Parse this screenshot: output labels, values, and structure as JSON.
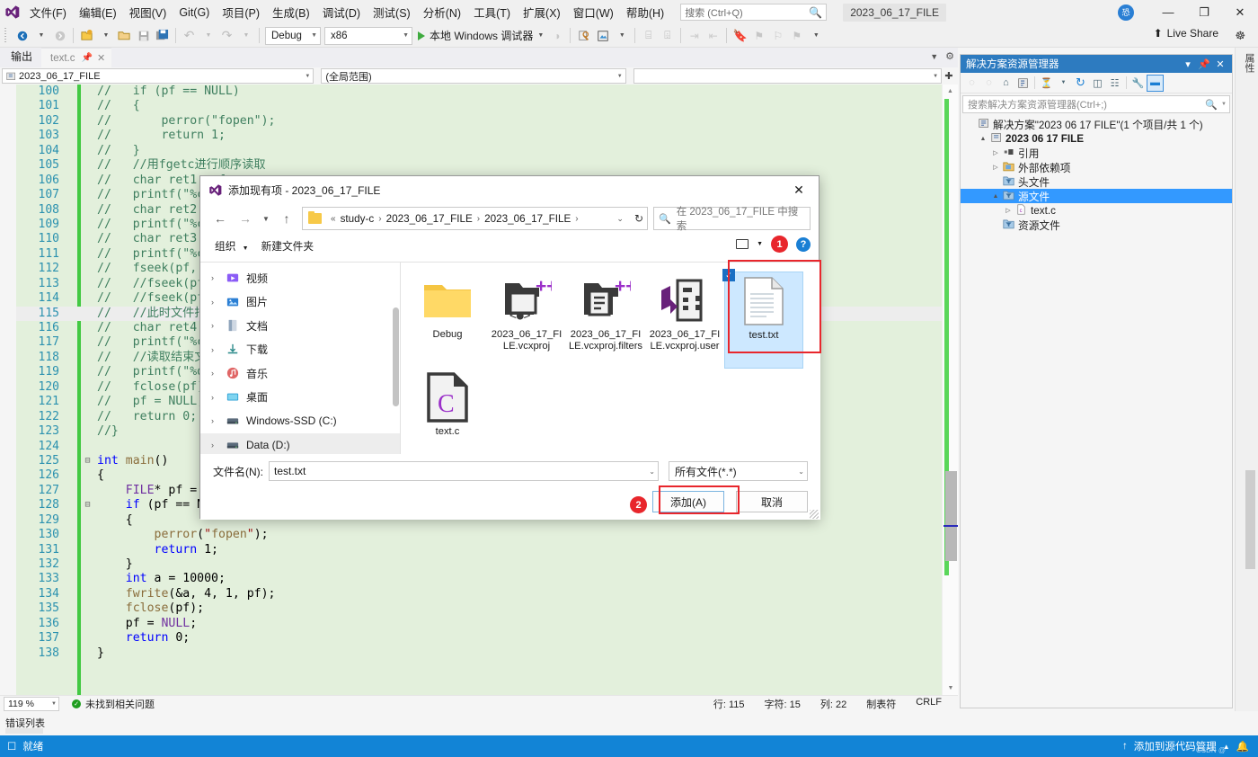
{
  "app": {
    "window_title": "2023_06_17_FILE",
    "logo_icon": "visual-studio-icon",
    "account_badge": "account-avatar"
  },
  "menu": {
    "items": [
      {
        "label": "文件(F)",
        "name": "menu-file"
      },
      {
        "label": "编辑(E)",
        "name": "menu-edit"
      },
      {
        "label": "视图(V)",
        "name": "menu-view"
      },
      {
        "label": "Git(G)",
        "name": "menu-git"
      },
      {
        "label": "项目(P)",
        "name": "menu-project"
      },
      {
        "label": "生成(B)",
        "name": "menu-build"
      },
      {
        "label": "调试(D)",
        "name": "menu-debug"
      },
      {
        "label": "测试(S)",
        "name": "menu-test"
      },
      {
        "label": "分析(N)",
        "name": "menu-analyze"
      },
      {
        "label": "工具(T)",
        "name": "menu-tools"
      },
      {
        "label": "扩展(X)",
        "name": "menu-extensions"
      },
      {
        "label": "窗口(W)",
        "name": "menu-window"
      },
      {
        "label": "帮助(H)",
        "name": "menu-help"
      }
    ],
    "quick_search_placeholder": "搜索 (Ctrl+Q)"
  },
  "window_controls": {
    "minimize": "—",
    "restore": "❐",
    "close": "✕"
  },
  "toolbar": {
    "config": "Debug",
    "platform": "x86",
    "run_label": "本地 Windows 调试器",
    "live_share": "Live Share"
  },
  "editor": {
    "output_tab": "输出",
    "doc_tab": "text.c",
    "nav_project": "2023_06_17_FILE",
    "nav_scope": "(全局范围)",
    "nav_member": "",
    "zoom": "119 %",
    "issues": "未找到相关问题",
    "status": {
      "line": "行: 115",
      "char": "字符: 15",
      "col": "列: 22",
      "indent": "制表符",
      "eol": "CRLF"
    },
    "error_list_label": "错误列表",
    "lines": [
      {
        "n": "100",
        "text": "//   if (pf == NULL)",
        "kind": "comment"
      },
      {
        "n": "101",
        "text": "//   {",
        "kind": "comment"
      },
      {
        "n": "102",
        "text": "//       perror(\"fopen\");",
        "kind": "comment"
      },
      {
        "n": "103",
        "text": "//       return 1;",
        "kind": "comment"
      },
      {
        "n": "104",
        "text": "//   }",
        "kind": "comment"
      },
      {
        "n": "105",
        "text": "//   //用fgetc进行顺序读取",
        "kind": "comment"
      },
      {
        "n": "106",
        "text": "//   char ret1 = f",
        "kind": "comment"
      },
      {
        "n": "107",
        "text": "//   printf(\"%c\\n\"",
        "kind": "comment"
      },
      {
        "n": "108",
        "text": "//   char ret2 = f",
        "kind": "comment"
      },
      {
        "n": "109",
        "text": "//   printf(\"%c\\n\"",
        "kind": "comment"
      },
      {
        "n": "110",
        "text": "//   char ret3 = f",
        "kind": "comment"
      },
      {
        "n": "111",
        "text": "//   printf(\"%c\\n\"",
        "kind": "comment"
      },
      {
        "n": "112",
        "text": "//   fseek(pf, 1,",
        "kind": "comment"
      },
      {
        "n": "113",
        "text": "//   //fseek(pf, -",
        "kind": "comment"
      },
      {
        "n": "114",
        "text": "//   //fseek(pf, -",
        "kind": "comment"
      },
      {
        "n": "115",
        "text": "//   //此时文件指针",
        "kind": "comment",
        "highlight": true
      },
      {
        "n": "116",
        "text": "//   char ret4 = f",
        "kind": "comment"
      },
      {
        "n": "117",
        "text": "//   printf(\"%c\\n\"",
        "kind": "comment"
      },
      {
        "n": "118",
        "text": "//   //读取结束文件",
        "kind": "comment"
      },
      {
        "n": "119",
        "text": "//   printf(\"%d\\n\"",
        "kind": "comment"
      },
      {
        "n": "120",
        "text": "//   fclose(pf);",
        "kind": "comment"
      },
      {
        "n": "121",
        "text": "//   pf = NULL;",
        "kind": "comment"
      },
      {
        "n": "122",
        "text": "//   return 0;",
        "kind": "comment"
      },
      {
        "n": "123",
        "text": "//}",
        "kind": "comment"
      },
      {
        "n": "124",
        "text": "",
        "kind": "blank"
      },
      {
        "n": "125",
        "text": "int main()",
        "kind": "code-main",
        "fold": "−"
      },
      {
        "n": "126",
        "text": "{",
        "kind": "code"
      },
      {
        "n": "127",
        "text": "    FILE* pf = fo",
        "kind": "code-file"
      },
      {
        "n": "128",
        "text": "    if (pf == NUL",
        "kind": "code-if",
        "fold": "−"
      },
      {
        "n": "129",
        "text": "    {",
        "kind": "code"
      },
      {
        "n": "130",
        "text": "        perror(\"fopen\");",
        "kind": "code-perror"
      },
      {
        "n": "131",
        "text": "        return 1;",
        "kind": "code-return1"
      },
      {
        "n": "132",
        "text": "    }",
        "kind": "code"
      },
      {
        "n": "133",
        "text": "    int a = 10000;",
        "kind": "code-int"
      },
      {
        "n": "134",
        "text": "    fwrite(&a, 4, 1, pf);",
        "kind": "code-fwrite"
      },
      {
        "n": "135",
        "text": "    fclose(pf);",
        "kind": "code-fclose"
      },
      {
        "n": "136",
        "text": "    pf = NULL;",
        "kind": "code-pfnull"
      },
      {
        "n": "137",
        "text": "    return 0;",
        "kind": "code-return0"
      },
      {
        "n": "138",
        "text": "}",
        "kind": "code"
      }
    ]
  },
  "solution_explorer": {
    "title": "解决方案资源管理器",
    "search_placeholder": "搜索解决方案资源管理器(Ctrl+;)",
    "tree": [
      {
        "label": "解决方案\"2023 06 17 FILE\"(1 个项目/共 1 个)",
        "icon": "solution-icon",
        "indent": 0,
        "arrow": "",
        "bold": false
      },
      {
        "label": "2023 06 17 FILE",
        "icon": "project-icon",
        "indent": 1,
        "arrow": "▲",
        "bold": true
      },
      {
        "label": "引用",
        "icon": "references-icon",
        "indent": 2,
        "arrow": "▷",
        "bold": false
      },
      {
        "label": "外部依赖项",
        "icon": "folder-icon",
        "indent": 2,
        "arrow": "▷",
        "bold": false
      },
      {
        "label": "头文件",
        "icon": "filter-icon",
        "indent": 2,
        "arrow": "",
        "bold": false
      },
      {
        "label": "源文件",
        "icon": "filter-icon",
        "indent": 2,
        "arrow": "▲",
        "bold": false,
        "selected": true
      },
      {
        "label": "text.c",
        "icon": "c-file-icon",
        "indent": 3,
        "arrow": "▷",
        "bold": false
      },
      {
        "label": "资源文件",
        "icon": "filter-icon",
        "indent": 2,
        "arrow": "",
        "bold": false
      }
    ],
    "vertical_strip_label": "属性"
  },
  "dialog": {
    "title": "添加现有项 - 2023_06_17_FILE",
    "title_icon": "visual-studio-icon",
    "breadcrumb": [
      "study-c",
      "2023_06_17_FILE",
      "2023_06_17_FILE"
    ],
    "breadcrumb_prefix": "«",
    "search_placeholder": "在 2023_06_17_FILE 中搜索",
    "commands": {
      "organize": "组织",
      "new_folder": "新建文件夹"
    },
    "badge_1": "1",
    "badge_2": "2",
    "sidebar": [
      {
        "label": "视频",
        "icon": "video-icon"
      },
      {
        "label": "图片",
        "icon": "picture-icon"
      },
      {
        "label": "文档",
        "icon": "document-icon"
      },
      {
        "label": "下载",
        "icon": "download-icon"
      },
      {
        "label": "音乐",
        "icon": "music-icon"
      },
      {
        "label": "桌面",
        "icon": "desktop-icon"
      },
      {
        "label": "Windows-SSD (C:)",
        "icon": "drive-icon"
      },
      {
        "label": "Data (D:)",
        "icon": "drive-icon",
        "selected": true
      }
    ],
    "files": [
      {
        "label": "Debug",
        "icon": "folder-icon",
        "selected": false
      },
      {
        "label": "2023_06_17_FILE.vcxproj",
        "icon": "vcxproj-icon",
        "selected": false
      },
      {
        "label": "2023_06_17_FILE.vcxproj.filters",
        "icon": "vcxproj-filters-icon",
        "selected": false
      },
      {
        "label": "2023_06_17_FILE.vcxproj.user",
        "icon": "vcxproj-user-icon",
        "selected": false
      },
      {
        "label": "test.txt",
        "icon": "text-file-icon",
        "selected": true
      },
      {
        "label": "text.c",
        "icon": "c-file-icon",
        "selected": false
      }
    ],
    "filename_label": "文件名(N):",
    "filename_value": "test.txt",
    "filter_value": "所有文件(*.*)",
    "add_button": "添加(A)",
    "cancel_button": "取消"
  },
  "taskbar": {
    "ready": "就绪",
    "source_control": "添加到源代码管理",
    "watermark": "CSDN @"
  },
  "colors": {
    "accent": "#1284d6",
    "selection": "#3399ff",
    "annotation": "#e8262c",
    "code_bg": "#e3f0dc",
    "change_bar": "#43c943"
  }
}
